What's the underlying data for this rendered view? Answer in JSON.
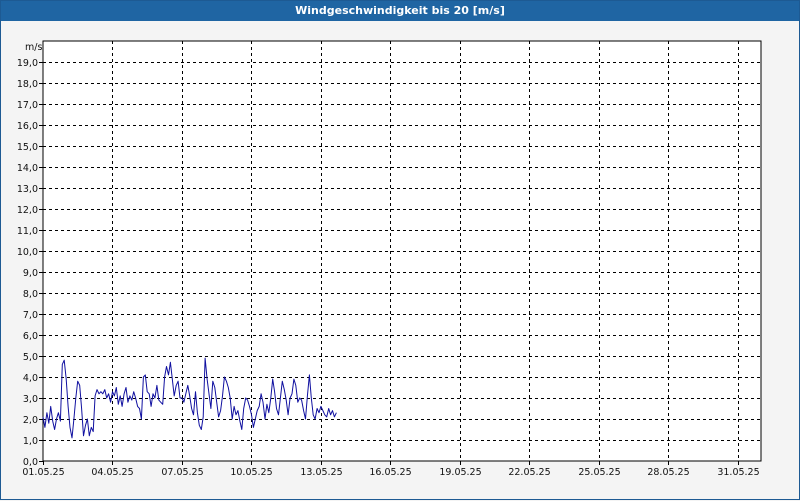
{
  "window": {
    "title": "Windgeschwindigkeit bis 20 [m/s]"
  },
  "colors": {
    "titlebar": "#1f65a3",
    "series": "#1010a0",
    "grid": "#000000",
    "plot_bg": "#ffffff"
  },
  "chart_data": {
    "type": "line",
    "title": "Windgeschwindigkeit bis 20 [m/s]",
    "ylabel": "m/s",
    "xlabel": "",
    "ylim": [
      0,
      20
    ],
    "yticks": [
      "0,0",
      "1,0",
      "2,0",
      "3,0",
      "4,0",
      "5,0",
      "6,0",
      "7,0",
      "8,0",
      "9,0",
      "10,0",
      "11,0",
      "12,0",
      "13,0",
      "14,0",
      "15,0",
      "16,0",
      "17,0",
      "18,0",
      "19,0"
    ],
    "xlim": [
      "01.05.25",
      "01.06.25"
    ],
    "xticks": [
      "01.05.25",
      "04.05.25",
      "07.05.25",
      "10.05.25",
      "13.05.25",
      "16.05.25",
      "19.05.25",
      "22.05.25",
      "25.05.25",
      "28.05.25",
      "31.05.25"
    ],
    "grid": true,
    "series": [
      {
        "color": "#1010a0",
        "x": [
          "01.05.25 00:00",
          "01.05.25 02:00",
          "01.05.25 04:00",
          "01.05.25 06:00",
          "01.05.25 08:00",
          "01.05.25 10:00",
          "01.05.25 12:00",
          "01.05.25 14:00",
          "01.05.25 16:00",
          "01.05.25 18:00",
          "01.05.25 20:00",
          "01.05.25 22:00",
          "02.05.25 00:00",
          "02.05.25 02:00",
          "02.05.25 04:00",
          "02.05.25 06:00",
          "02.05.25 08:00",
          "02.05.25 10:00",
          "02.05.25 12:00",
          "02.05.25 14:00",
          "02.05.25 16:00",
          "02.05.25 18:00",
          "02.05.25 20:00",
          "02.05.25 22:00",
          "03.05.25 00:00",
          "03.05.25 02:00",
          "03.05.25 04:00",
          "03.05.25 06:00",
          "03.05.25 08:00",
          "03.05.25 10:00",
          "03.05.25 12:00",
          "03.05.25 14:00",
          "03.05.25 16:00",
          "03.05.25 18:00",
          "03.05.25 20:00",
          "03.05.25 22:00",
          "04.05.25 00:00",
          "04.05.25 02:00",
          "04.05.25 04:00",
          "04.05.25 06:00",
          "04.05.25 08:00",
          "04.05.25 10:00",
          "04.05.25 12:00",
          "04.05.25 14:00",
          "04.05.25 16:00",
          "04.05.25 18:00",
          "04.05.25 20:00",
          "04.05.25 22:00",
          "05.05.25 00:00",
          "05.05.25 02:00",
          "05.05.25 04:00",
          "05.05.25 06:00",
          "05.05.25 08:00",
          "05.05.25 10:00",
          "05.05.25 12:00",
          "05.05.25 14:00",
          "05.05.25 16:00",
          "05.05.25 18:00",
          "05.05.25 20:00",
          "05.05.25 22:00",
          "06.05.25 00:00",
          "06.05.25 02:00",
          "06.05.25 04:00",
          "06.05.25 06:00",
          "06.05.25 08:00",
          "06.05.25 10:00",
          "06.05.25 12:00",
          "06.05.25 14:00",
          "06.05.25 16:00",
          "06.05.25 18:00",
          "06.05.25 20:00",
          "06.05.25 22:00",
          "07.05.25 00:00",
          "07.05.25 02:00",
          "07.05.25 04:00",
          "07.05.25 06:00",
          "07.05.25 08:00",
          "07.05.25 10:00",
          "07.05.25 12:00",
          "07.05.25 14:00",
          "07.05.25 16:00",
          "07.05.25 18:00",
          "07.05.25 20:00",
          "07.05.25 22:00",
          "08.05.25 00:00",
          "08.05.25 02:00",
          "08.05.25 04:00",
          "08.05.25 06:00",
          "08.05.25 08:00",
          "08.05.25 10:00",
          "08.05.25 12:00",
          "08.05.25 14:00",
          "08.05.25 16:00",
          "08.05.25 18:00",
          "08.05.25 20:00",
          "08.05.25 22:00",
          "09.05.25 00:00",
          "09.05.25 02:00",
          "09.05.25 04:00",
          "09.05.25 06:00",
          "09.05.25 08:00",
          "09.05.25 10:00",
          "09.05.25 12:00",
          "09.05.25 14:00",
          "09.05.25 16:00",
          "09.05.25 18:00",
          "09.05.25 20:00",
          "09.05.25 22:00",
          "10.05.25 00:00",
          "10.05.25 02:00",
          "10.05.25 04:00",
          "10.05.25 06:00",
          "10.05.25 08:00",
          "10.05.25 10:00",
          "10.05.25 12:00",
          "10.05.25 14:00",
          "10.05.25 16:00",
          "10.05.25 18:00",
          "10.05.25 20:00",
          "10.05.25 22:00",
          "11.05.25 00:00",
          "11.05.25 02:00",
          "11.05.25 04:00",
          "11.05.25 06:00",
          "11.05.25 08:00",
          "11.05.25 10:00",
          "11.05.25 12:00",
          "11.05.25 14:00",
          "11.05.25 16:00",
          "11.05.25 18:00",
          "11.05.25 20:00",
          "11.05.25 22:00",
          "12.05.25 00:00",
          "12.05.25 02:00",
          "12.05.25 04:00",
          "12.05.25 06:00",
          "12.05.25 08:00",
          "12.05.25 10:00",
          "12.05.25 12:00",
          "12.05.25 14:00",
          "12.05.25 16:00",
          "12.05.25 18:00",
          "12.05.25 20:00",
          "12.05.25 22:00",
          "13.05.25 00:00",
          "13.05.25 02:00",
          "13.05.25 04:00",
          "13.05.25 06:00",
          "13.05.25 08:00",
          "13.05.25 10:00",
          "13.05.25 12:00",
          "13.05.25 14:00",
          "13.05.25 16:00"
        ],
        "y": [
          2.1,
          1.6,
          2.3,
          1.8,
          2.6,
          1.9,
          1.5,
          2.0,
          2.3,
          1.9,
          4.6,
          4.8,
          3.9,
          2.6,
          1.6,
          1.1,
          2.0,
          3.0,
          3.8,
          3.6,
          2.5,
          1.2,
          1.7,
          2.0,
          1.2,
          1.6,
          1.4,
          3.1,
          3.4,
          3.2,
          3.3,
          3.2,
          3.4,
          3.0,
          3.2,
          2.8,
          3.3,
          3.1,
          3.5,
          2.7,
          3.1,
          2.6,
          3.2,
          3.5,
          2.8,
          3.1,
          2.9,
          3.3,
          3.0,
          2.6,
          2.5,
          2.0,
          4.0,
          4.1,
          3.3,
          3.2,
          2.6,
          3.2,
          3.0,
          3.6,
          2.9,
          2.8,
          2.7,
          4.0,
          4.5,
          4.1,
          4.7,
          3.9,
          3.1,
          3.6,
          3.8,
          3.0,
          3.0,
          2.8,
          3.2,
          3.6,
          3.1,
          2.5,
          2.2,
          3.3,
          2.3,
          1.7,
          1.5,
          2.1,
          4.9,
          3.9,
          3.2,
          2.5,
          3.8,
          3.5,
          2.8,
          2.1,
          2.4,
          3.1,
          4.0,
          3.8,
          3.5,
          3.0,
          2.0,
          2.6,
          2.2,
          2.4,
          1.9,
          1.5,
          2.5,
          3.0,
          2.9,
          2.6,
          2.2,
          1.6,
          2.0,
          2.4,
          2.6,
          3.2,
          2.8,
          2.0,
          2.7,
          2.3,
          3.0,
          3.9,
          3.3,
          2.5,
          2.2,
          3.0,
          3.8,
          3.4,
          2.9,
          2.2,
          3.0,
          3.2,
          3.9,
          3.6,
          2.8,
          3.0,
          2.9,
          2.4,
          2.0,
          3.1,
          4.1,
          3.0,
          2.2,
          2.0,
          2.5,
          2.3,
          2.6,
          2.4,
          2.2,
          2.1,
          2.5,
          2.2,
          2.4,
          2.1,
          2.3
        ]
      }
    ]
  }
}
